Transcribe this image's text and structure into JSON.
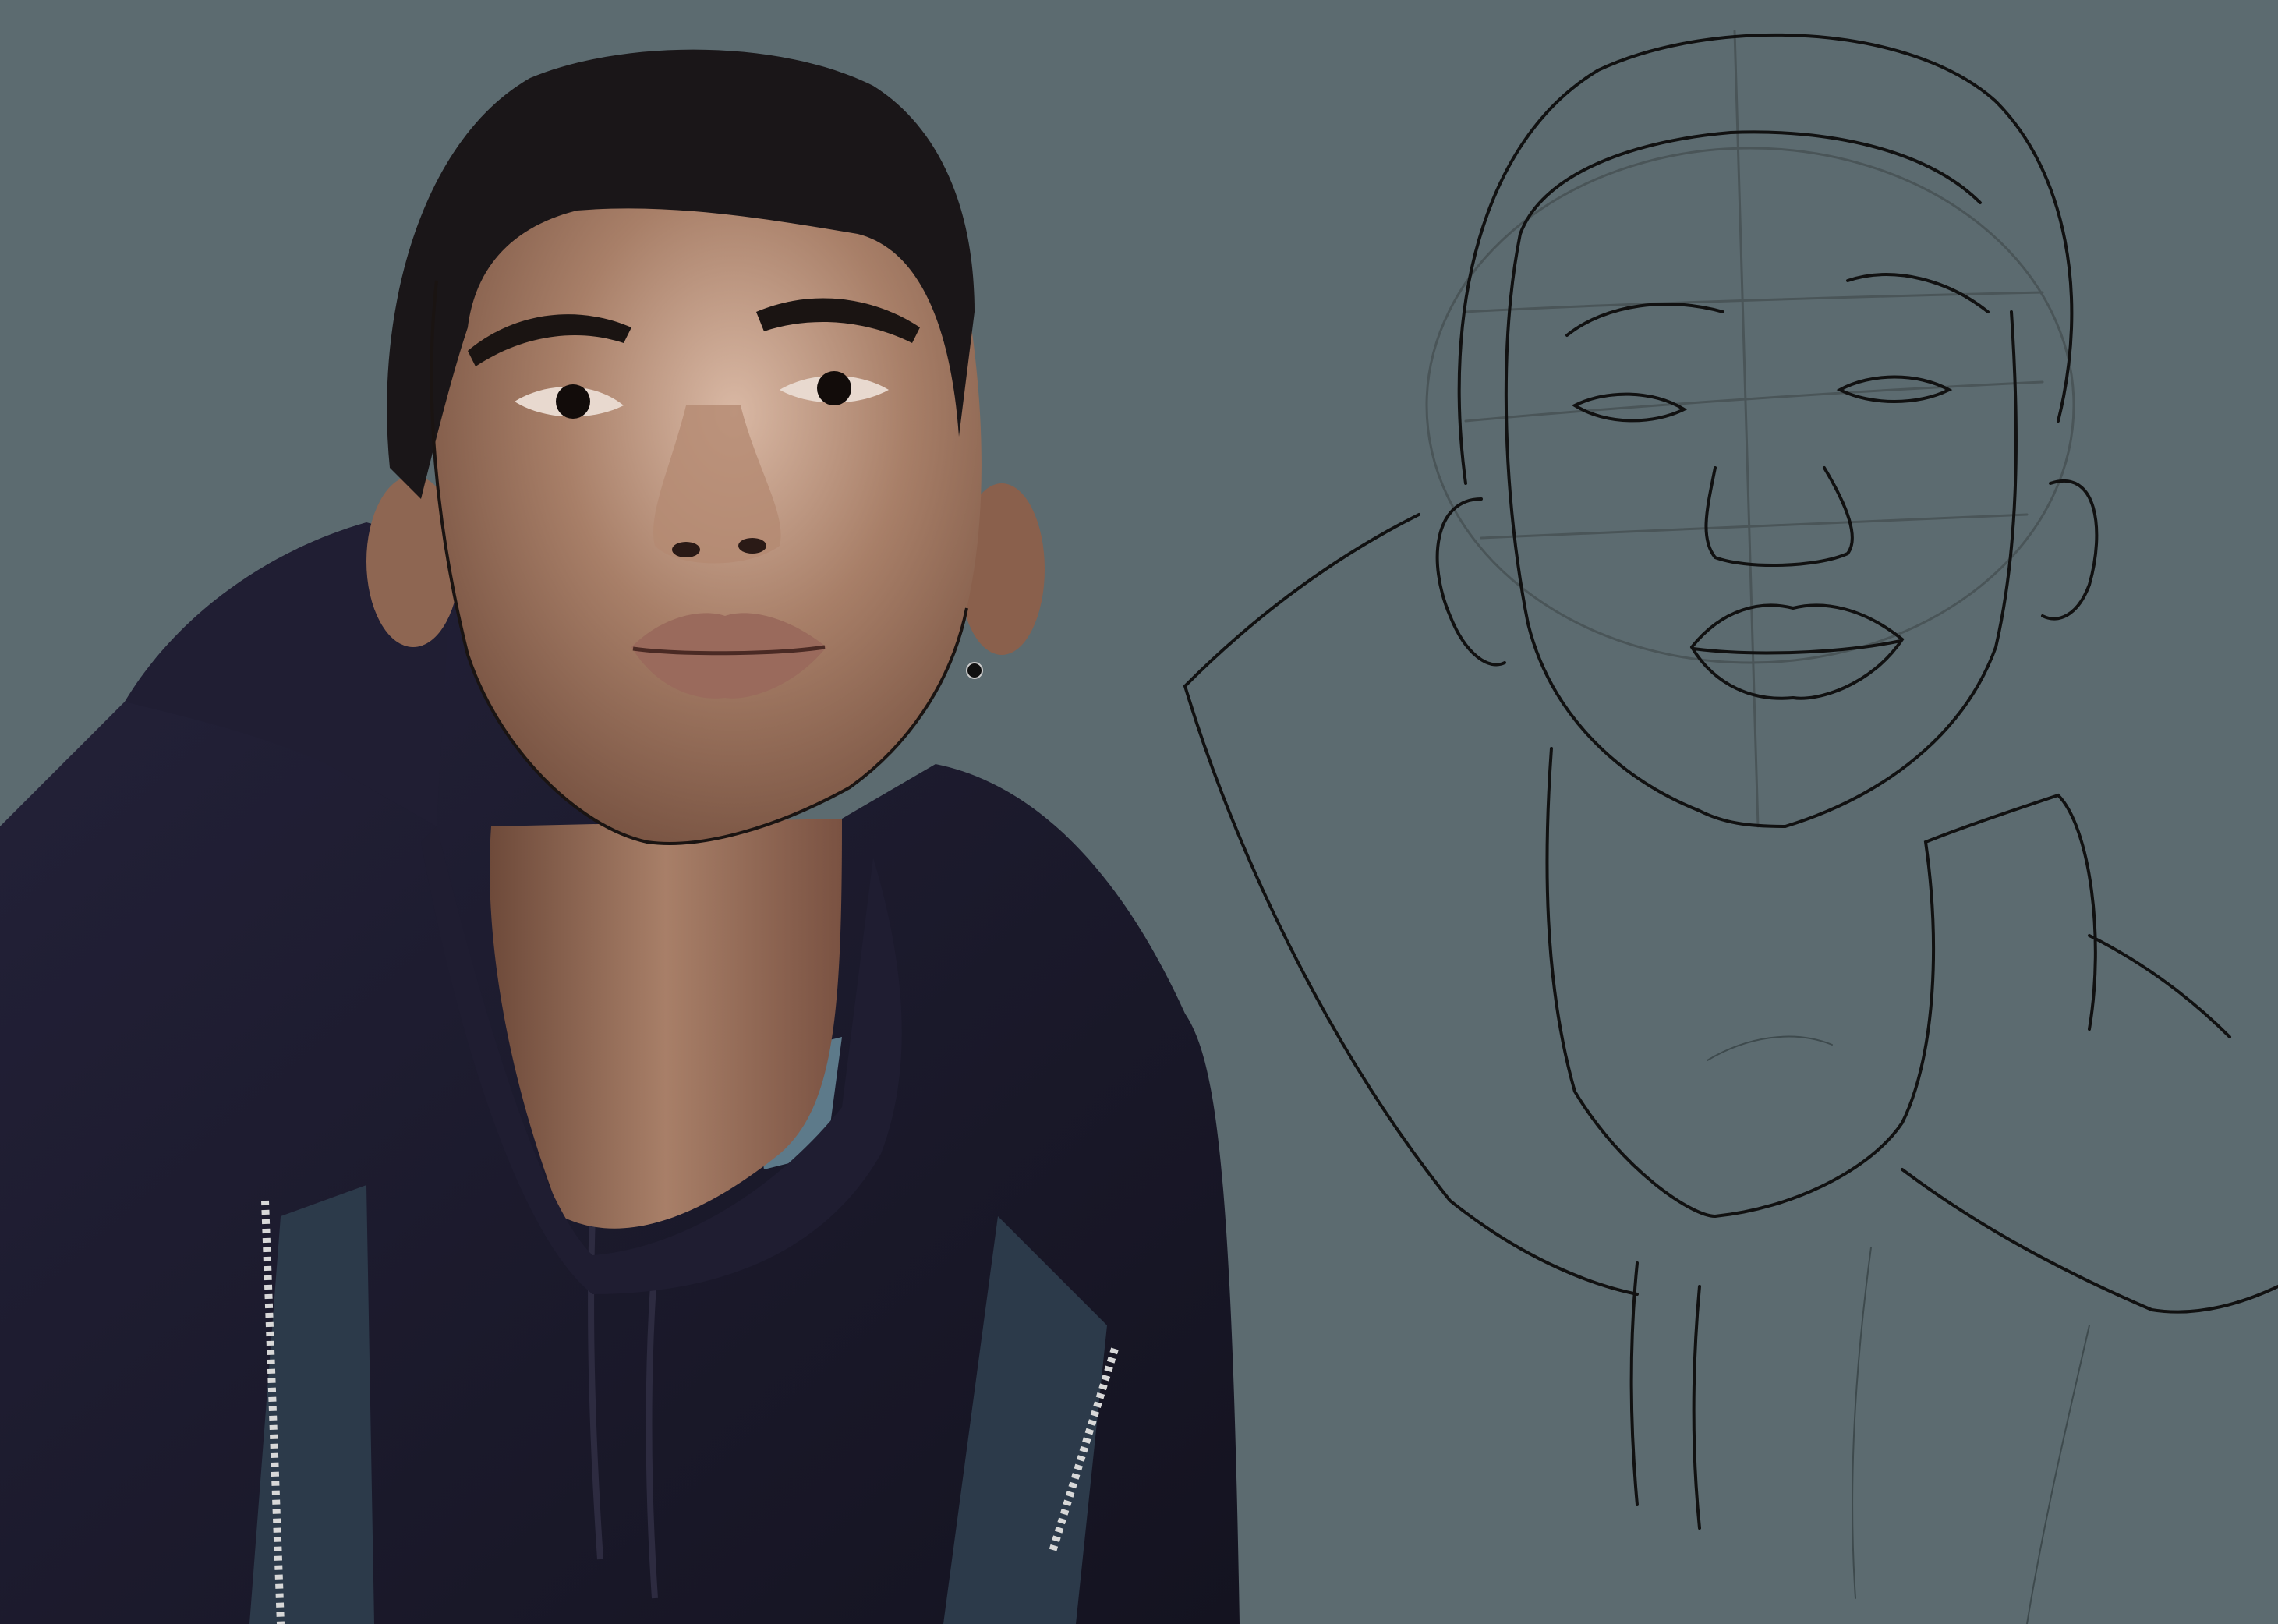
{
  "artwork": {
    "background_color": "#5c6b70",
    "panels": [
      {
        "name": "painted-portrait",
        "style": "digital painting",
        "colors": {
          "skin_mid": "#a87f68",
          "skin_shadow": "#6e4a3a",
          "skin_highlight": "#d9b8a4",
          "hair": "#1a1618",
          "hoodie": "#1c1a2b",
          "jacket_panel": "#2c3a4a",
          "lips": "#9a6a5c",
          "zipper": "#d8d8d8"
        }
      },
      {
        "name": "line-sketch",
        "style": "line art with construction guides",
        "colors": {
          "ink": "#111111",
          "guide_lines": "#4a5558"
        }
      }
    ]
  }
}
